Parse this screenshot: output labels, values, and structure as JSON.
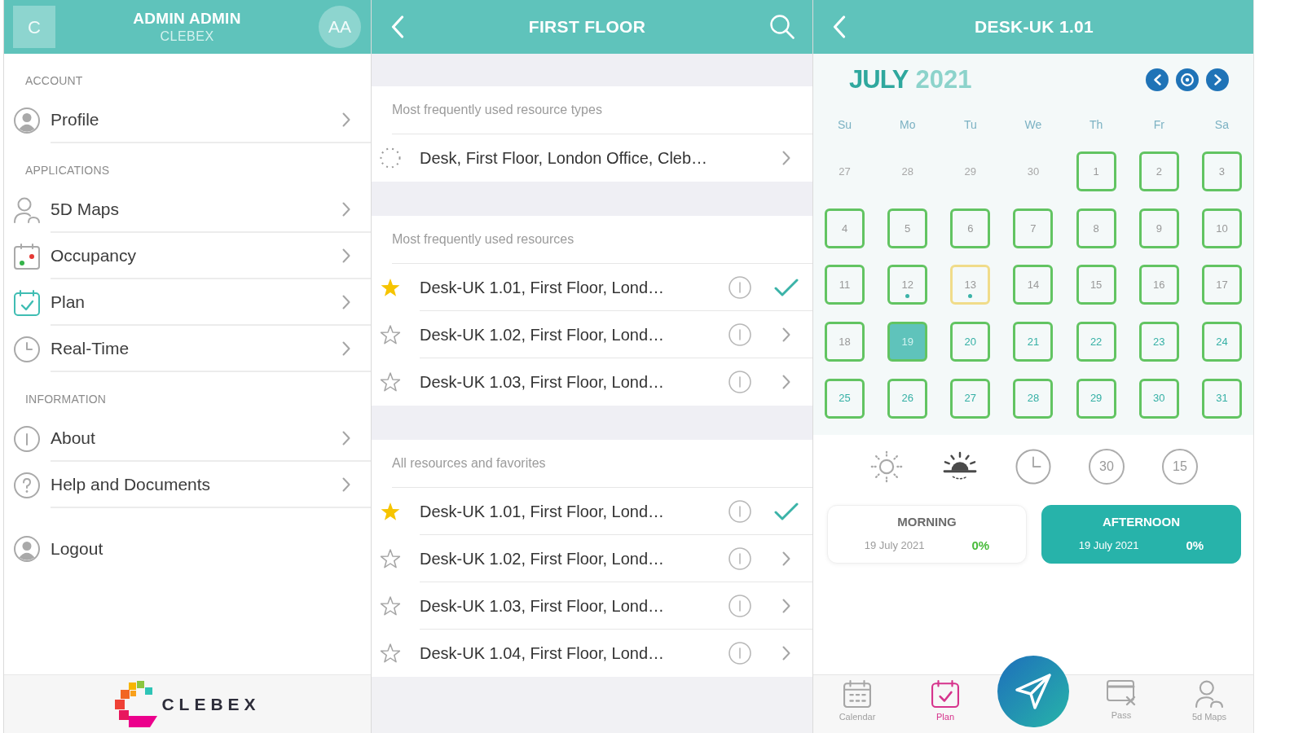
{
  "menu_panel": {
    "header": {
      "initial": "C",
      "name": "ADMIN ADMIN",
      "company": "CLEBEX",
      "avatar": "AA"
    },
    "sections": [
      {
        "title": "ACCOUNT",
        "items": [
          {
            "kind": "profile",
            "label": "Profile",
            "selected": false,
            "chevron": true
          }
        ]
      },
      {
        "title": "APPLICATIONS",
        "items": [
          {
            "kind": "maps",
            "label": "5D Maps",
            "selected": false,
            "chevron": true
          },
          {
            "kind": "occupancy",
            "label": "Occupancy",
            "selected": false,
            "chevron": true
          },
          {
            "kind": "plan",
            "label": "Plan",
            "selected": true,
            "chevron": true
          },
          {
            "kind": "realtime",
            "label": "Real-Time",
            "selected": false,
            "chevron": true
          }
        ]
      },
      {
        "title": "INFORMATION",
        "items": [
          {
            "kind": "about",
            "label": "About",
            "selected": false,
            "chevron": true
          },
          {
            "kind": "help",
            "label": "Help and Documents",
            "selected": false,
            "chevron": true
          }
        ]
      },
      {
        "items": [
          {
            "kind": "logout",
            "label": "Logout",
            "selected": false,
            "chevron": false
          }
        ]
      }
    ],
    "footer": {
      "logo_text": "CLEBEX"
    }
  },
  "floor_panel": {
    "title": "FIRST FLOOR",
    "sections": [
      {
        "title": "Most frequently used resource types",
        "rows": [
          {
            "kind": "type",
            "label": "Desk, First Floor, London Office, Cleb…"
          }
        ]
      },
      {
        "title": "Most frequently used resources",
        "rows": [
          {
            "kind": "resource",
            "label": "Desk-UK 1.01, First Floor, Lond…",
            "favorite": true,
            "selected": true
          },
          {
            "kind": "resource",
            "label": "Desk-UK 1.02, First Floor, Lond…",
            "favorite": false,
            "selected": false
          },
          {
            "kind": "resource",
            "label": "Desk-UK 1.03, First Floor, Lond…",
            "favorite": false,
            "selected": false
          }
        ]
      },
      {
        "title": "All resources and favorites",
        "rows": [
          {
            "kind": "resource",
            "label": "Desk-UK 1.01, First Floor, Lond…",
            "favorite": true,
            "selected": true
          },
          {
            "kind": "resource",
            "label": "Desk-UK 1.02, First Floor, Lond…",
            "favorite": false,
            "selected": false
          },
          {
            "kind": "resource",
            "label": "Desk-UK 1.03, First Floor, Lond…",
            "favorite": false,
            "selected": false
          },
          {
            "kind": "resource",
            "label": "Desk-UK 1.04, First Floor, Lond…",
            "favorite": false,
            "selected": false
          }
        ]
      }
    ]
  },
  "desk_panel": {
    "title": "DESK-UK 1.01",
    "calendar": {
      "month": "JULY",
      "year": "2021",
      "weekdays": [
        "Su",
        "Mo",
        "Tu",
        "We",
        "Th",
        "Fr",
        "Sa"
      ],
      "days": [
        {
          "day": "27",
          "kind": "outside",
          "selected": false,
          "dot": false
        },
        {
          "day": "28",
          "kind": "outside",
          "selected": false,
          "dot": false
        },
        {
          "day": "29",
          "kind": "outside",
          "selected": false,
          "dot": false
        },
        {
          "day": "30",
          "kind": "outside",
          "selected": false,
          "dot": false
        },
        {
          "day": "1",
          "kind": "past",
          "color": "#62c462",
          "selected": false,
          "dot": false
        },
        {
          "day": "2",
          "kind": "past",
          "color": "#62c462",
          "selected": false,
          "dot": false
        },
        {
          "day": "3",
          "kind": "past",
          "color": "#62c462",
          "selected": false,
          "dot": false
        },
        {
          "day": "4",
          "kind": "past",
          "color": "#62c462",
          "selected": false,
          "dot": false
        },
        {
          "day": "5",
          "kind": "past",
          "color": "#62c462",
          "selected": false,
          "dot": false
        },
        {
          "day": "6",
          "kind": "past",
          "color": "#62c462",
          "selected": false,
          "dot": false
        },
        {
          "day": "7",
          "kind": "past",
          "color": "#62c462",
          "selected": false,
          "dot": false
        },
        {
          "day": "8",
          "kind": "past",
          "color": "#62c462",
          "selected": false,
          "dot": false
        },
        {
          "day": "9",
          "kind": "past",
          "color": "#62c462",
          "selected": false,
          "dot": false
        },
        {
          "day": "10",
          "kind": "past",
          "color": "#62c462",
          "selected": false,
          "dot": false
        },
        {
          "day": "11",
          "kind": "past",
          "color": "#62c462",
          "selected": false,
          "dot": false
        },
        {
          "day": "12",
          "kind": "past",
          "color": "#62c462",
          "selected": false,
          "dot": true
        },
        {
          "day": "13",
          "kind": "past",
          "color": "#f0dc8a",
          "selected": false,
          "dot": true
        },
        {
          "day": "14",
          "kind": "past",
          "color": "#62c462",
          "selected": false,
          "dot": false
        },
        {
          "day": "15",
          "kind": "past",
          "color": "#62c462",
          "selected": false,
          "dot": false
        },
        {
          "day": "16",
          "kind": "past",
          "color": "#62c462",
          "selected": false,
          "dot": false
        },
        {
          "day": "17",
          "kind": "past",
          "color": "#62c462",
          "selected": false,
          "dot": false
        },
        {
          "day": "18",
          "kind": "past",
          "color": "#62c462",
          "selected": false,
          "dot": false
        },
        {
          "day": "19",
          "kind": "future",
          "color": "#62c462",
          "selected": true,
          "dot": false
        },
        {
          "day": "20",
          "kind": "future",
          "color": "#62c462",
          "selected": false,
          "dot": false
        },
        {
          "day": "21",
          "kind": "future",
          "color": "#62c462",
          "selected": false,
          "dot": false
        },
        {
          "day": "22",
          "kind": "future",
          "color": "#62c462",
          "selected": false,
          "dot": false
        },
        {
          "day": "23",
          "kind": "future",
          "color": "#62c462",
          "selected": false,
          "dot": false
        },
        {
          "day": "24",
          "kind": "future",
          "color": "#62c462",
          "selected": false,
          "dot": false
        },
        {
          "day": "25",
          "kind": "future",
          "color": "#62c462",
          "selected": false,
          "dot": false
        },
        {
          "day": "26",
          "kind": "future",
          "color": "#62c462",
          "selected": false,
          "dot": false
        },
        {
          "day": "27",
          "kind": "future",
          "color": "#62c462",
          "selected": false,
          "dot": false
        },
        {
          "day": "28",
          "kind": "future",
          "color": "#62c462",
          "selected": false,
          "dot": false
        },
        {
          "day": "29",
          "kind": "future",
          "color": "#62c462",
          "selected": false,
          "dot": false
        },
        {
          "day": "30",
          "kind": "future",
          "color": "#62c462",
          "selected": false,
          "dot": false
        },
        {
          "day": "31",
          "kind": "future",
          "color": "#62c462",
          "selected": false,
          "dot": false
        }
      ]
    },
    "slot_filters": [
      {
        "kind": "sun",
        "selected": false
      },
      {
        "kind": "sunrise",
        "selected": true
      },
      {
        "kind": "clock",
        "selected": false
      },
      {
        "kind": "minutes",
        "label": "30",
        "selected": false
      },
      {
        "kind": "minutes",
        "label": "15",
        "selected": false
      }
    ],
    "periods": [
      {
        "title": "MORNING",
        "date": "19 July 2021",
        "occupancy": "0%",
        "selected": false
      },
      {
        "title": "AFTERNOON",
        "date": "19 July 2021",
        "occupancy": "0%",
        "selected": true
      }
    ],
    "tab_bar": [
      {
        "kind": "calendar",
        "label": "Calendar",
        "selected": false
      },
      {
        "kind": "plan",
        "label": "Plan",
        "selected": true
      },
      {
        "kind": "pass",
        "label": "Pass",
        "selected": false
      },
      {
        "kind": "maps",
        "label": "5d Maps",
        "selected": false
      }
    ]
  }
}
